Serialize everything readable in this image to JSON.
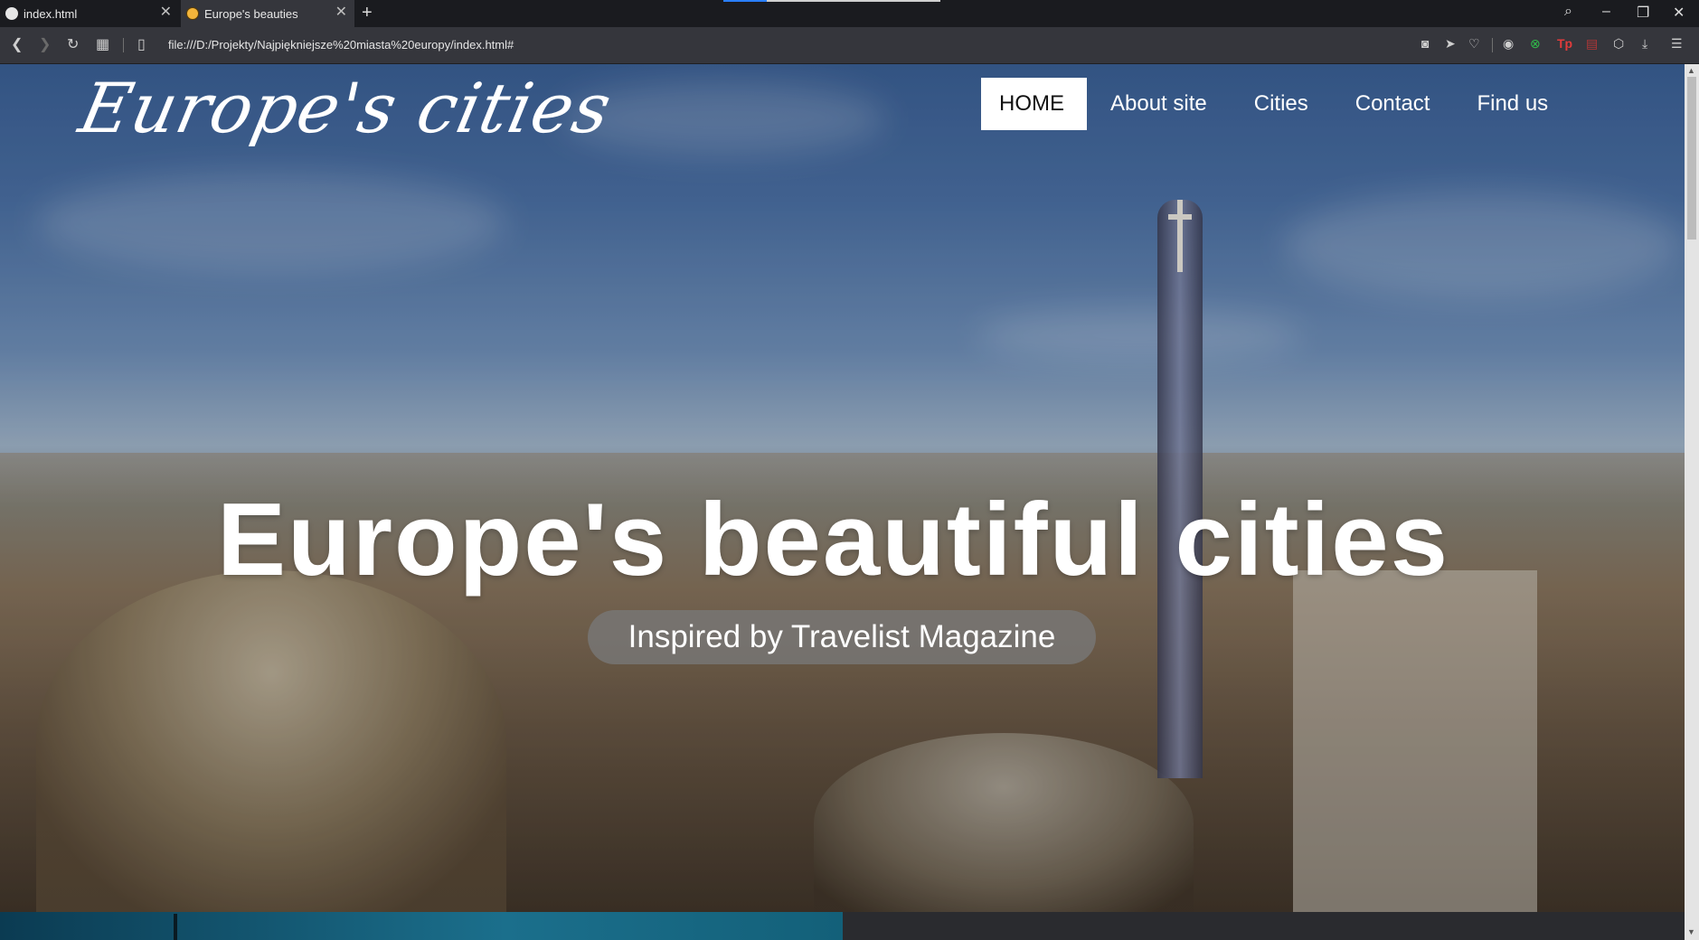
{
  "browser": {
    "tabs": [
      {
        "title": "index.html",
        "active": false
      },
      {
        "title": "Europe's beauties",
        "active": true
      }
    ],
    "new_tab_icon": "plus-icon",
    "url": "file:///D:/Projekty/Najpiękniejsze%20miasta%20europy/index.html#"
  },
  "site": {
    "logo": "Europe's cities",
    "nav": [
      {
        "label": "HOME",
        "active": true
      },
      {
        "label": "About site",
        "active": false
      },
      {
        "label": "Cities",
        "active": false
      },
      {
        "label": "Contact",
        "active": false
      },
      {
        "label": "Find us",
        "active": false
      }
    ],
    "hero": {
      "headline": "Europe's beautiful cities",
      "subtitle": "Inspired by Travelist Magazine"
    }
  },
  "colors": {
    "chrome_dark": "#1a1b1f",
    "chrome_bar": "#35363c",
    "nav_active_bg": "#ffffff",
    "pill_bg": "#787878"
  }
}
